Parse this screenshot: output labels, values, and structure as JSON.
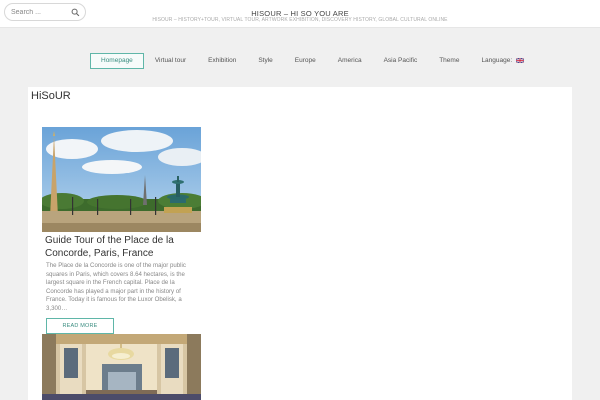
{
  "header": {
    "search_placeholder": "Search ...",
    "site_title": "HISOUR – HI SO YOU ARE",
    "tagline": "HISOUR – HISTORY+TOUR, VIRTUAL TOUR, ARTWORK EXHIBITION, DISCOVERY HISTORY, GLOBAL CULTURAL ONLINE"
  },
  "nav": {
    "items": [
      "Homepage",
      "Virtual tour",
      "Exhibition",
      "Style",
      "Europe",
      "America",
      "Asia Pacific",
      "Theme"
    ],
    "language_label": "Language:",
    "accent_color": "#5fb6a8"
  },
  "main": {
    "page_title": "HiSoUR",
    "post": {
      "title": "Guide Tour of the Place de la Concorde, Paris, France",
      "excerpt": "The Place de la Concorde is one of the major public squares in Paris, which covers 8.64 hectares, is the largest square in the French capital. Place de la Concorde has played a major part in the history of France. Today it is famous for the Luxor Obelisk, a 3,300…",
      "read_more": "READ MORE"
    }
  }
}
